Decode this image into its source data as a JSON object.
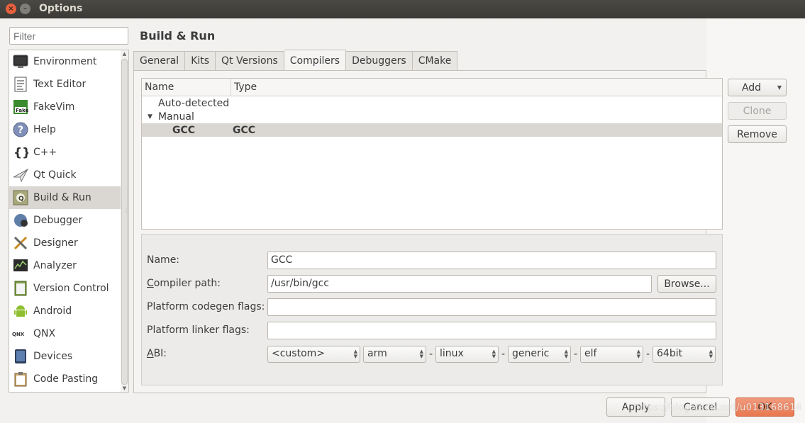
{
  "window": {
    "title": "Options",
    "close_glyph": "×",
    "minimize_glyph": "–"
  },
  "filter": {
    "placeholder": "Filter"
  },
  "sidebar": {
    "items": [
      {
        "label": "Environment",
        "icon": "monitor-icon"
      },
      {
        "label": "Text Editor",
        "icon": "text-document-icon"
      },
      {
        "label": "FakeVim",
        "icon": "fakevim-icon"
      },
      {
        "label": "Help",
        "icon": "help-icon"
      },
      {
        "label": "C++",
        "icon": "braces-icon"
      },
      {
        "label": "Qt Quick",
        "icon": "paper-plane-icon"
      },
      {
        "label": "Build & Run",
        "icon": "build-run-icon",
        "active": true
      },
      {
        "label": "Debugger",
        "icon": "bug-icon"
      },
      {
        "label": "Designer",
        "icon": "designer-tools-icon"
      },
      {
        "label": "Analyzer",
        "icon": "analyzer-icon"
      },
      {
        "label": "Version Control",
        "icon": "version-control-icon"
      },
      {
        "label": "Android",
        "icon": "android-icon"
      },
      {
        "label": "QNX",
        "icon": "qnx-icon"
      },
      {
        "label": "Devices",
        "icon": "device-icon"
      },
      {
        "label": "Code Pasting",
        "icon": "clipboard-icon"
      }
    ]
  },
  "page": {
    "title": "Build & Run"
  },
  "tabs": [
    {
      "label": "General"
    },
    {
      "label": "Kits"
    },
    {
      "label": "Qt Versions"
    },
    {
      "label": "Compilers",
      "active": true
    },
    {
      "label": "Debuggers"
    },
    {
      "label": "CMake"
    }
  ],
  "tree": {
    "headers": {
      "name": "Name",
      "type": "Type"
    },
    "groups": {
      "auto": "Auto-detected",
      "manual": "Manual"
    },
    "selected_row": {
      "name": "GCC",
      "type": "GCC"
    }
  },
  "side_buttons": {
    "add": "Add",
    "clone": "Clone",
    "remove": "Remove"
  },
  "form": {
    "name_label": "Name:",
    "name_value": "GCC",
    "path_label_first": "C",
    "path_label_rest": "ompiler path:",
    "path_value": "/usr/bin/gcc",
    "browse": "Browse...",
    "codegen_label": "Platform codegen flags:",
    "codegen_value": "",
    "linker_label": "Platform linker flags:",
    "linker_value": "",
    "abi_label_first": "A",
    "abi_label_rest": "BI:",
    "abi": [
      "<custom>",
      "arm",
      "linux",
      "generic",
      "elf",
      "64bit"
    ],
    "separator": "-"
  },
  "footer": {
    "apply": "Apply",
    "cancel": "Cancel",
    "ok": "OK"
  },
  "watermark": "https://blog.csdn.net/u013168614",
  "colors": {
    "titlebar": "#3b3a36",
    "ok_button": "#e8784f",
    "selection": "#dad7d2",
    "close_button": "#e8603e"
  }
}
